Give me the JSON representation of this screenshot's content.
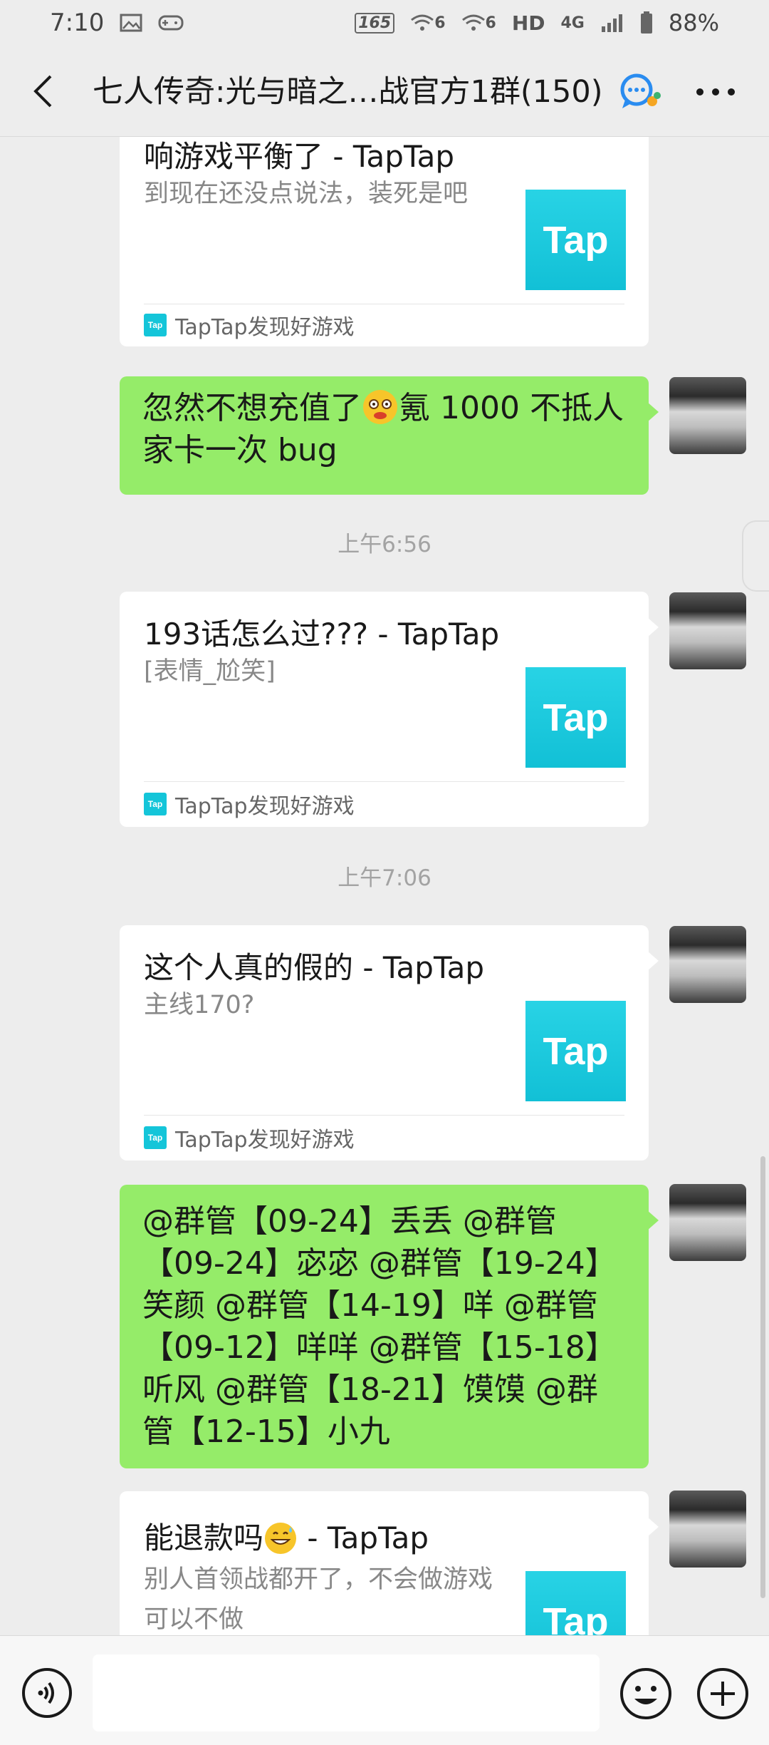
{
  "status_bar": {
    "time": "7:10",
    "refresh_rate": "165",
    "wifi_label_1": "6",
    "wifi_label_2": "6",
    "hd": "HD",
    "network": "4G",
    "battery": "88%"
  },
  "header": {
    "title": "七人传奇:光与暗之…战官方1群(150)"
  },
  "messages": {
    "card1": {
      "title": "响游戏平衡了 - TapTap",
      "desc": "到现在还没点说法，装死是吧",
      "thumb": "Tap",
      "source": "TapTap发现好游戏"
    },
    "green1": {
      "text_a": "忽然不想充值了",
      "text_b": "氪 1000 不抵人家卡一次 bug"
    },
    "time1": "上午6:56",
    "card2": {
      "title": "193话怎么过???   - TapTap",
      "desc": "[表情_尬笑]",
      "thumb": "Tap",
      "source": "TapTap发现好游戏"
    },
    "time2": "上午7:06",
    "card3": {
      "title": "这个人真的假的 - TapTap",
      "desc": "主线170?",
      "thumb": "Tap",
      "source": "TapTap发现好游戏"
    },
    "green2": {
      "text": "@群管【09-24】丢丢  @群管【09-24】宓宓  @群管【19-24】笑颜  @群管【14-19】咩  @群管【09-12】咩咩  @群管【15-18】听风  @群管【18-21】馍馍  @群管【12-15】小九"
    },
    "card4": {
      "title_a": "能退款吗",
      "title_b": " - TapTap",
      "desc": "别人首领战都开了，不会做游戏可以不做",
      "thumb": "Tap"
    }
  },
  "input": {
    "value": ""
  }
}
